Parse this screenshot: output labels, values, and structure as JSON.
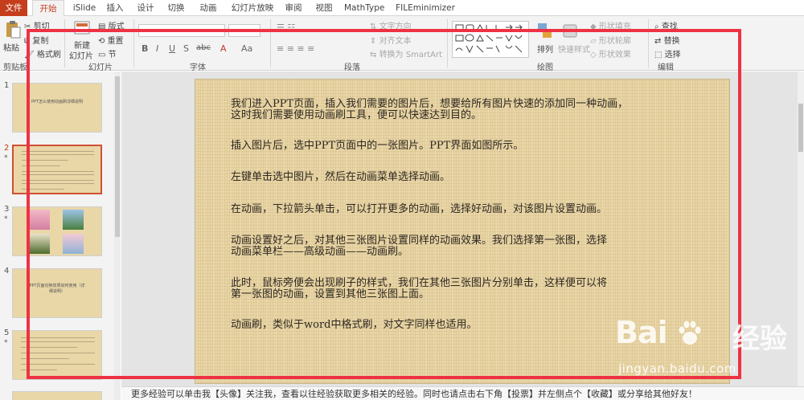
{
  "ribbon": {
    "tabs": [
      "文件",
      "开始",
      "iSlide",
      "插入",
      "设计",
      "切换",
      "动画",
      "幻灯片放映",
      "审阅",
      "视图",
      "MathType",
      "FILEminimizer"
    ],
    "active_tab": "开始",
    "clipboard": {
      "paste": "粘贴",
      "cut": "剪切",
      "copy": "复制",
      "format_painter": "格式刷",
      "label": "剪贴板"
    },
    "slides": {
      "new_slide_line1": "新建",
      "new_slide_line2": "幻灯片",
      "layout": "版式",
      "reset": "重置",
      "section": "节",
      "label": "幻灯片"
    },
    "font": {
      "bold": "B",
      "italic": "I",
      "underline": "U",
      "strike": "S",
      "shadow": "abc",
      "label": "字体"
    },
    "paragraph": {
      "text_direction": "文字方向",
      "align_text": "对齐文本",
      "smartart": "转换为 SmartArt",
      "label": "段落"
    },
    "drawing": {
      "arrange": "排列",
      "quick_styles": "快速样式",
      "shape_fill": "形状填充",
      "shape_outline": "形状轮廓",
      "shape_effects": "形状效果",
      "label": "绘图"
    },
    "editing": {
      "find": "查找",
      "replace": "替换",
      "select": "选择",
      "label": "编辑"
    }
  },
  "slide_panel": {
    "slides": [
      {
        "num": "1",
        "title": "PPT怎么使用动画刷详细说明",
        "star": false
      },
      {
        "num": "2",
        "title": "",
        "star": true
      },
      {
        "num": "3",
        "title": "",
        "star": true
      },
      {
        "num": "4",
        "title": "PPT页面切换效果如何使用（详细说明）",
        "star": false
      },
      {
        "num": "5",
        "title": "",
        "star": true
      }
    ]
  },
  "slide": {
    "paragraphs": [
      {
        "line1": "我们进入PPT页面，插入我们需要的图片后，想要给所有图片快速的添加同一种动画，",
        "line2": "这时我们需要使用动画刷工具，便可以快速达到目的。"
      },
      {
        "line1": "插入图片后，选中PPT页面中的一张图片。PPT界面如图所示。"
      },
      {
        "line1": "左键单击选中图片，然后在动画菜单选择动画。"
      },
      {
        "line1": "在动画，下拉箭头单击，可以打开更多的动画，选择好动画，对该图片设置动画。"
      },
      {
        "line1": "动画设置好之后，对其他三张图片设置同样的动画效果。我们选择第一张图，选择",
        "line2": "动画菜单栏——高级动画——动画刷。"
      },
      {
        "line1": "此时，鼠标旁便会出现刷子的样式，我们在其他三张图片分别单击，这样便可以将",
        "line2": "第一张图的动画，设置到其他三张图上面。"
      },
      {
        "line1": "动画刷，类似于word中格式刷，对文字同样也适用。"
      }
    ]
  },
  "notes_bar": "更多经验可以单击我【头像】关注我，查看以往经验获取更多相关的经验。同时也请点击右下角【投票】并左侧点个【收藏】或分享给其他好友！",
  "watermark": {
    "brand": "Bai",
    "brand_cn": "经验",
    "url": "jingyan.baidu.com"
  },
  "colors": {
    "accent": "#c43e1c",
    "highlight_box": "#ee3244",
    "slide_bg": "#e8d4a4"
  }
}
